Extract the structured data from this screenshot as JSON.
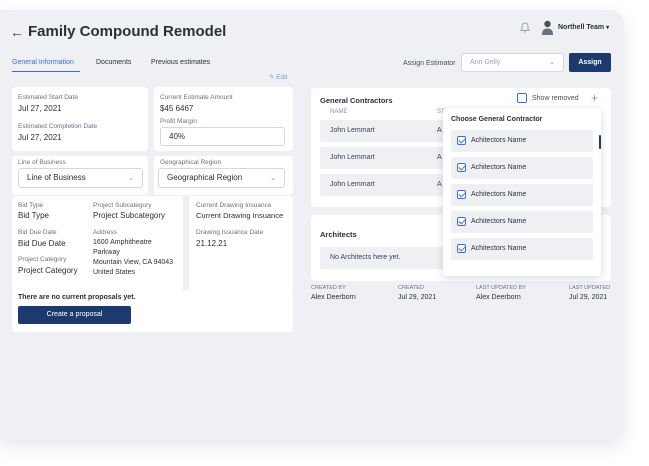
{
  "header": {
    "title": "Family Compound Remodel",
    "user_name": "Northell Team",
    "back_icon": "arrow-left-icon",
    "bell_icon": "bell-icon"
  },
  "tabs": [
    {
      "label": "General Information",
      "active": true
    },
    {
      "label": "Documents",
      "active": false
    },
    {
      "label": "Previous estimates",
      "active": false
    }
  ],
  "assign": {
    "label": "Assign Estimator",
    "selected": "Ann Gelly",
    "button": "Assign"
  },
  "edit_label": "Edit",
  "dates": {
    "start_label": "Estimated Start Date",
    "start_value": "Jul 27, 2021",
    "completion_label": "Estimated Completion Date",
    "completion_value": "Jul 27, 2021",
    "amount_label": "Current Estimate Amount",
    "amount_value": "$45 6467",
    "margin_label": "Profit Margin",
    "margin_value": "40%"
  },
  "business": {
    "line_label": "Line of Business",
    "line_value": "Line of Business",
    "region_label": "Geographical Region",
    "region_value": "Geographical Region"
  },
  "bid": {
    "type_label": "Bid Type",
    "type_value": "Bid Type",
    "subcat_label": "Project Subcategory",
    "subcat_value": "Project Subcategory",
    "due_label": "Bid Due Date",
    "due_value": "Bid Due Date",
    "address_label": "Address",
    "address_line1": "1600 Amphitheatre",
    "address_line2": "Parkway",
    "address_line3": "Mountain View, CA 94043",
    "address_line4": "United States",
    "category_label": "Project Category",
    "category_value": "Project Category"
  },
  "drawing": {
    "current_label": "Current Drawing Insuance",
    "current_value": "Current Drawing Insuance",
    "date_label": "Drawing Issuance Date",
    "date_value": "21.12.21"
  },
  "proposals": {
    "empty_text": "There are no current proposals yet.",
    "button": "Create a proposal"
  },
  "contractors": {
    "title": "General Contractors",
    "show_removed": "Show removed",
    "col_name": "NAME",
    "col_status_partial": "ST",
    "rows": [
      {
        "name": "John Lemmart",
        "partial": "A"
      },
      {
        "name": "John Lemmart",
        "partial": "A"
      },
      {
        "name": "John Lemmart",
        "partial": "A"
      }
    ]
  },
  "dropdown": {
    "title": "Choose General Contractor",
    "items": [
      "Achitectors Name",
      "Achitectors Name",
      "Achitectors Name",
      "Achitectors Name",
      "Achitectors Name"
    ]
  },
  "architects": {
    "title": "Architects",
    "empty": "No Architects here yet."
  },
  "meta": {
    "created_by_label": "CREATED BY",
    "created_by_value": "Alex Deerborn",
    "created_label": "CREATED",
    "created_value": "Jul 29, 2021",
    "updated_by_label": "LAST UPDATED BY",
    "updated_by_value": "Alex Deerborn",
    "updated_label": "LAST UPDATED",
    "updated_value": "Jul 29, 2021"
  },
  "colors": {
    "accent": "#1d3a6e",
    "tab_active": "#3b6fd6",
    "background": "#eef0f4"
  }
}
